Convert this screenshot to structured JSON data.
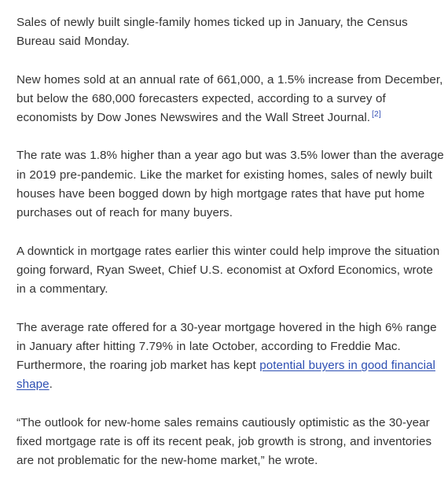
{
  "article": {
    "p1": "Sales of newly built single-family homes ticked up in January, the Census Bureau said Monday.",
    "p2": {
      "text": "New homes sold at an annual rate of 661,000, a 1.5% increase from December, but below the 680,000 forecasters expected, according to a survey of economists by Dow Jones Newswires and the Wall Street Journal.",
      "citation": "[2]"
    },
    "p3": "The rate was 1.8% higher than a year ago but was 3.5% lower than the average in 2019 pre-pandemic. Like the market for existing homes, sales of newly built houses have been bogged down by high mortgage rates that have put home purchases out of reach for many buyers.",
    "p4": "A downtick in mortgage rates earlier this winter could help improve the situation going forward, Ryan Sweet, Chief U.S. economist at Oxford Economics, wrote in a commentary.",
    "p5": {
      "text_before": "The average rate offered for a 30-year mortgage hovered in the high 6% range in January after hitting 7.79% in late October, according to Freddie Mac. Furthermore, the roaring job market has kept ",
      "link": "potential buyers in good financial shape",
      "text_after": "."
    },
    "p6": "“The outlook for new-home sales remains cautiously optimistic as the 30-year fixed mortgage rate is off its recent peak, job growth is strong, and inventories are not problematic for the new-home market,” he wrote."
  },
  "colors": {
    "body_text": "#333333",
    "link": "#2d4fb3",
    "citation": "#3b55b8",
    "background": "#ffffff"
  }
}
